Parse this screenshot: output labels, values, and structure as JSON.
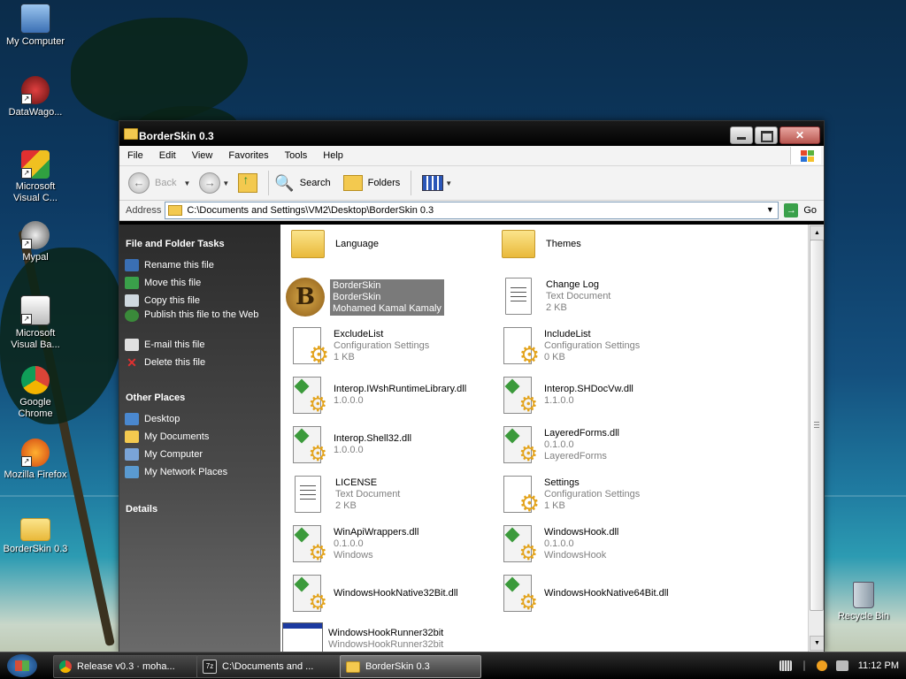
{
  "desktop": {
    "icons": [
      {
        "label": "My Computer"
      },
      {
        "label": "DataWago..."
      },
      {
        "label": "Microsoft Visual C..."
      },
      {
        "label": "Mypal"
      },
      {
        "label": "Microsoft Visual Ba..."
      },
      {
        "label": "Google Chrome"
      },
      {
        "label": "Mozilla Firefox"
      },
      {
        "label": "BorderSkin 0.3"
      },
      {
        "label": "Recycle Bin"
      }
    ]
  },
  "window": {
    "title": "BorderSkin 0.3",
    "menu": [
      "File",
      "Edit",
      "View",
      "Favorites",
      "Tools",
      "Help"
    ],
    "toolbar": {
      "back": "Back",
      "search": "Search",
      "folders": "Folders"
    },
    "address": {
      "label": "Address",
      "value": "C:\\Documents and Settings\\VM2\\Desktop\\BorderSkin 0.3",
      "go": "Go"
    },
    "tasks": {
      "file_folder_title": "File and Folder Tasks",
      "file_folder": [
        "Rename this file",
        "Move this file",
        "Copy this file",
        "Publish this file to the Web",
        "E-mail this file",
        "Delete this file"
      ],
      "other_places_title": "Other Places",
      "other_places": [
        "Desktop",
        "My Documents",
        "My Computer",
        "My Network Places"
      ],
      "details_title": "Details"
    },
    "files": [
      {
        "name": "Language",
        "line2": "",
        "line3": "",
        "icon": "folder-icon"
      },
      {
        "name": "Themes",
        "line2": "",
        "line3": "",
        "icon": "folder-icon"
      },
      {
        "name": "BorderSkin",
        "line2": "BorderSkin",
        "line3": "Mohamed Kamal Kamaly",
        "icon": "app-icon",
        "selected": true
      },
      {
        "name": "Change Log",
        "line2": "Text Document",
        "line3": "2 KB",
        "icon": "text-document-icon"
      },
      {
        "name": "ExcludeList",
        "line2": "Configuration Settings",
        "line3": "1 KB",
        "icon": "config-file-icon"
      },
      {
        "name": "IncludeList",
        "line2": "Configuration Settings",
        "line3": "0 KB",
        "icon": "config-file-icon"
      },
      {
        "name": "Interop.IWshRuntimeLibrary.dll",
        "line2": "1.0.0.0",
        "line3": "",
        "icon": "dll-icon"
      },
      {
        "name": "Interop.SHDocVw.dll",
        "line2": "1.1.0.0",
        "line3": "",
        "icon": "dll-icon"
      },
      {
        "name": "Interop.Shell32.dll",
        "line2": "1.0.0.0",
        "line3": "",
        "icon": "dll-icon"
      },
      {
        "name": "LayeredForms.dll",
        "line2": "0.1.0.0",
        "line3": "LayeredForms",
        "icon": "dll-icon"
      },
      {
        "name": "LICENSE",
        "line2": "Text Document",
        "line3": "2 KB",
        "icon": "text-document-icon"
      },
      {
        "name": "Settings",
        "line2": "Configuration Settings",
        "line3": "1 KB",
        "icon": "config-file-icon"
      },
      {
        "name": "WinApiWrappers.dll",
        "line2": "0.1.0.0",
        "line3": "Windows",
        "icon": "dll-icon"
      },
      {
        "name": "WindowsHook.dll",
        "line2": "0.1.0.0",
        "line3": "WindowsHook",
        "icon": "dll-icon"
      },
      {
        "name": "WindowsHookNative32Bit.dll",
        "line2": "",
        "line3": "",
        "icon": "dll-icon"
      },
      {
        "name": "WindowsHookNative64Bit.dll",
        "line2": "",
        "line3": "",
        "icon": "dll-icon"
      },
      {
        "name": "WindowsHookRunner32bit",
        "line2": "WindowsHookRunner32bit",
        "line3": "",
        "icon": "exe-icon"
      }
    ]
  },
  "taskbar": {
    "tasks": [
      {
        "label": "Release v0.3 · moha..."
      },
      {
        "label": "C:\\Documents and ..."
      },
      {
        "label": "BorderSkin 0.3"
      }
    ],
    "clock": "11:12 PM"
  },
  "colors": {
    "selection": "#7a7a7a",
    "task_pane_top": "#2b2b2b",
    "title_bar": "#000000"
  }
}
